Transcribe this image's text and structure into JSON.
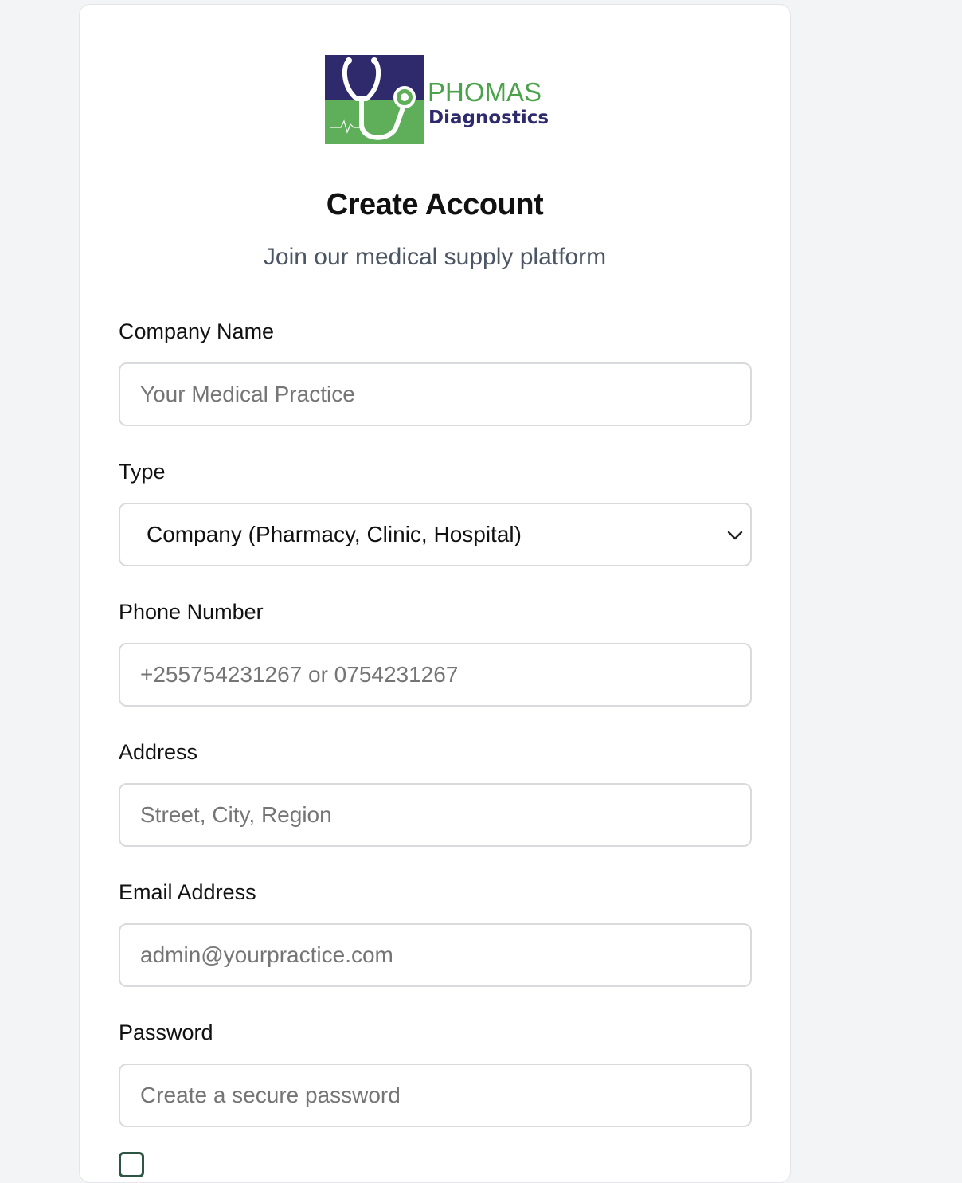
{
  "brand": {
    "logo_line1": "PHOMAS",
    "logo_line2": "Diagnostics",
    "colors": {
      "navy": "#2e2a6b",
      "green": "#5fae5a",
      "text_green": "#4aa24a",
      "text_navy": "#2d2a6e"
    }
  },
  "header": {
    "title": "Create Account",
    "subtitle": "Join our medical supply platform"
  },
  "form": {
    "company_name": {
      "label": "Company Name",
      "placeholder": "Your Medical Practice"
    },
    "type": {
      "label": "Type",
      "value": "Company (Pharmacy, Clinic, Hospital)"
    },
    "phone": {
      "label": "Phone Number",
      "placeholder": "+255754231267 or 0754231267"
    },
    "address": {
      "label": "Address",
      "placeholder": "Street, City, Region"
    },
    "email": {
      "label": "Email Address",
      "placeholder": "admin@yourpractice.com"
    },
    "password": {
      "label": "Password",
      "placeholder": "Create a secure password"
    }
  }
}
